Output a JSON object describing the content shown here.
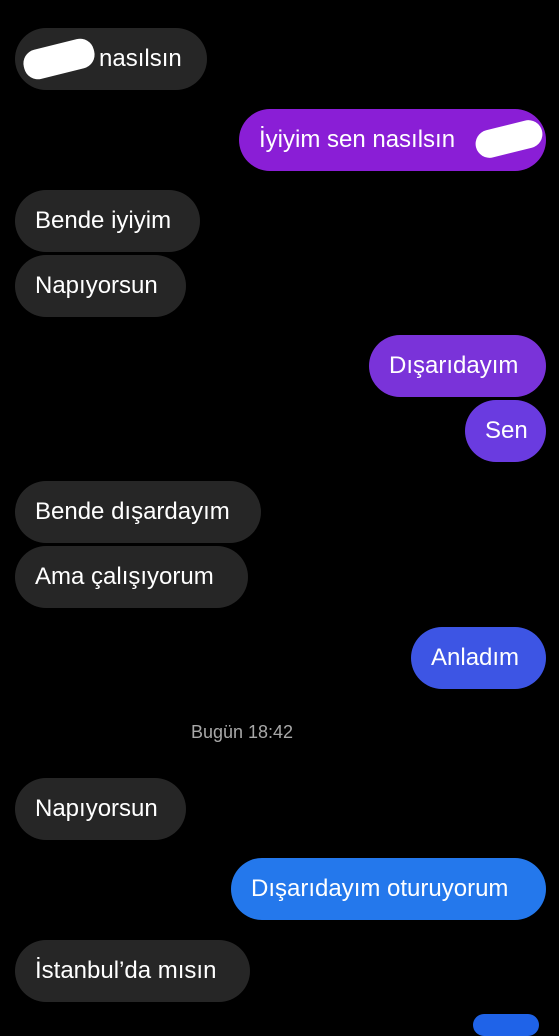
{
  "colors": {
    "background": "#000000",
    "incoming_bubble": "#262626",
    "text": "#ffffff",
    "timestamp": "#a8a8a8"
  },
  "messages": [
    {
      "from": "them",
      "text": "nasılsın",
      "redacted_prefix": true
    },
    {
      "from": "me",
      "text": "İyiyim sen nasılsın",
      "redacted_suffix": true,
      "color": "#8a1ed6"
    },
    {
      "from": "them",
      "text": "Bende iyiyim"
    },
    {
      "from": "them",
      "text": "Napıyorsun"
    },
    {
      "from": "me",
      "text": "Dışarıdayım",
      "color": "#7a33d9"
    },
    {
      "from": "me",
      "text": "Sen",
      "color": "#6a3be0"
    },
    {
      "from": "them",
      "text": "Bende dışardayım"
    },
    {
      "from": "them",
      "text": "Ama çalışıyorum"
    },
    {
      "from": "me",
      "text": "Anladım",
      "color": "#3d55e4"
    },
    {
      "from": "them",
      "text": "Napıyorsun"
    },
    {
      "from": "me",
      "text": "Dışarıdayım oturuyorum",
      "color": "#2478ec"
    },
    {
      "from": "them",
      "text": "İstanbul’da mısın"
    }
  ],
  "timestamp": "Bugün 18:42"
}
